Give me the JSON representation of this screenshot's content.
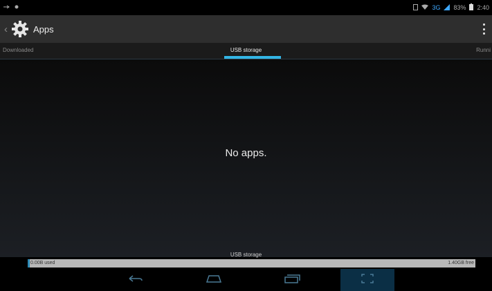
{
  "status_bar": {
    "time": "2:40",
    "battery_percent": "83%"
  },
  "action_bar": {
    "title": "Apps"
  },
  "tabs": [
    {
      "label": "Downloaded",
      "selected": false
    },
    {
      "label": "USB storage",
      "selected": true
    },
    {
      "label": "Runni",
      "selected": false
    }
  ],
  "content": {
    "empty_message": "No apps."
  },
  "storage": {
    "title": "USB storage",
    "used_label": "0.00B used",
    "free_label": "1.40GB free",
    "used_fraction": 0.005
  },
  "nav": {
    "buttons": [
      "back-icon",
      "home-icon",
      "recent-apps-icon",
      "screenshot-icon"
    ]
  },
  "colors": {
    "accent": "#33b5e5",
    "action_bar": "#2e2e2e",
    "storage_used": "#2d89b5",
    "storage_free": "#b8b8b8"
  }
}
